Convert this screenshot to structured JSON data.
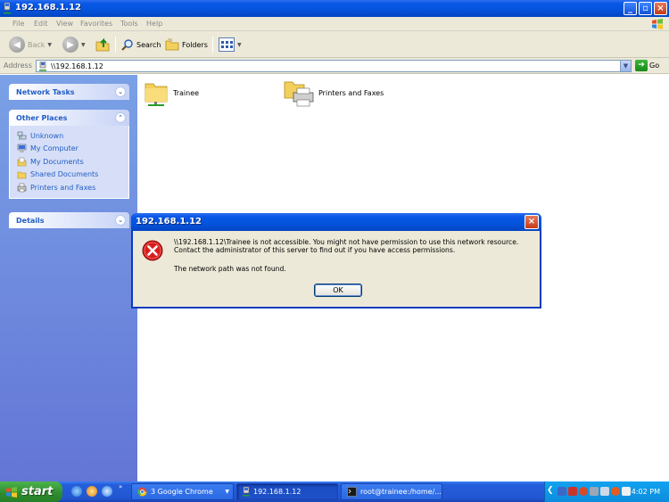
{
  "window": {
    "title": "192.168.1.12"
  },
  "menu": {
    "items": [
      "File",
      "Edit",
      "View",
      "Favorites",
      "Tools",
      "Help"
    ]
  },
  "toolbar": {
    "back_label": "Back",
    "search_label": "Search",
    "folders_label": "Folders"
  },
  "address": {
    "label": "Address",
    "value": "\\\\192.168.1.12",
    "go_label": "Go"
  },
  "sidebar": {
    "network_tasks": {
      "title": "Network Tasks"
    },
    "other_places": {
      "title": "Other Places",
      "items": [
        "Unknown",
        "My Computer",
        "My Documents",
        "Shared Documents",
        "Printers and Faxes"
      ]
    },
    "details": {
      "title": "Details"
    }
  },
  "content": {
    "items": [
      {
        "label": "Trainee",
        "icon": "shared-folder-icon"
      },
      {
        "label": "Printers and Faxes",
        "icon": "printers-folder-icon"
      }
    ]
  },
  "dialog": {
    "title": "192.168.1.12",
    "message": "\\\\192.168.1.12\\Trainee is not accessible. You might not have permission to use this network resource. Contact the administrator of this server to find out if you have access permissions.",
    "detail": "The network path was not found.",
    "ok_label": "OK"
  },
  "taskbar": {
    "start_label": "start",
    "tasks": [
      "3 Google Chrome",
      "192.168.1.12",
      "root@trainee:/home/..."
    ],
    "clock": "4:02 PM"
  },
  "colors": {
    "xp_blue": "#0453dc",
    "pane_blue": "#6375d6",
    "link_blue": "#215dc6",
    "start_green": "#2e8b2e"
  }
}
